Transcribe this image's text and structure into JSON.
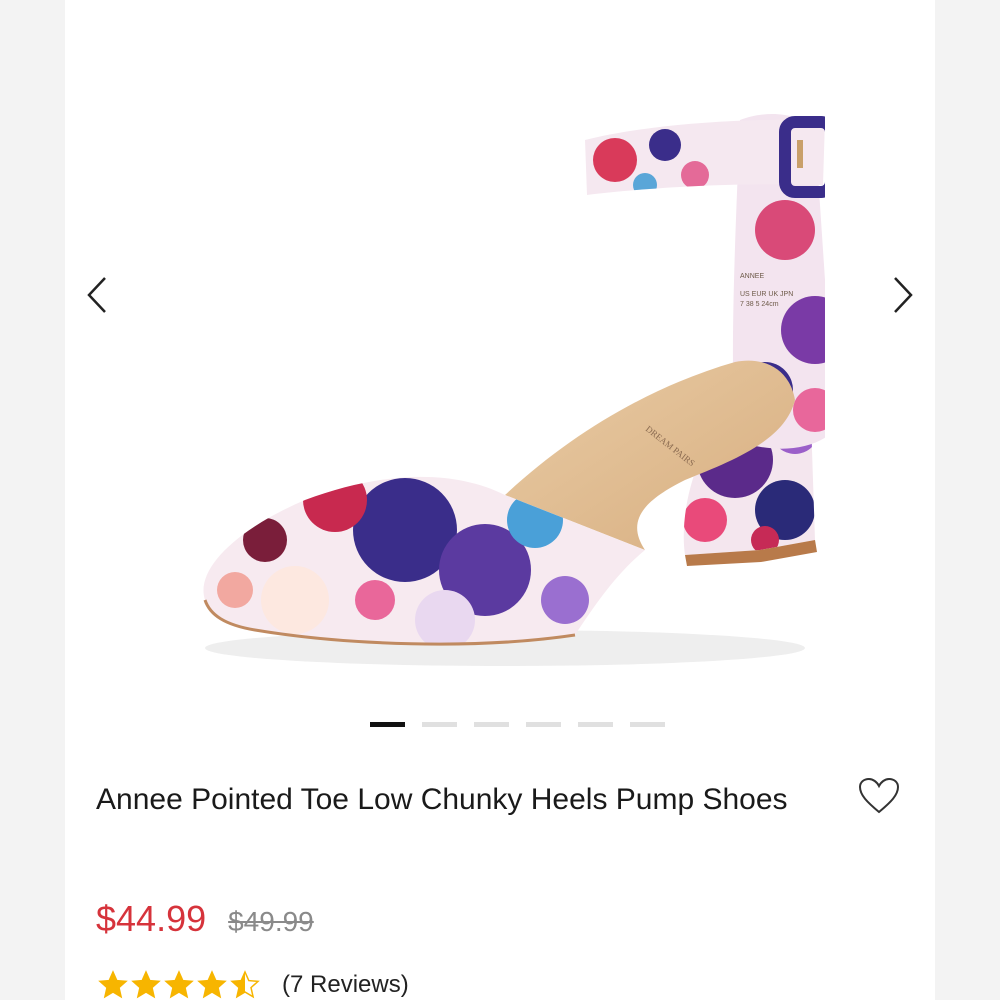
{
  "product": {
    "title": "Annee Pointed Toe Low Chunky Heels Pump Shoes",
    "price_current": "$44.99",
    "price_original": "$49.99",
    "rating": 4.5,
    "rating_max": 5,
    "reviews_label": "(7 Reviews)",
    "image_icon": "floral-ankle-strap-pump-shoe",
    "insole_brand": "DREAM PAIRS",
    "insole_model": "ANNEE",
    "insole_size_header": "US EUR UK JPN",
    "insole_size_values": "7 38 5 24cm"
  },
  "gallery": {
    "slide_count": 6,
    "active_index": 0,
    "prev_icon": "chevron-left-icon",
    "next_icon": "chevron-right-icon"
  },
  "icons": {
    "wishlist": "heart-outline-icon",
    "star": "star-icon"
  },
  "colors": {
    "price_current": "#d6333b",
    "price_original": "#8a8a8a",
    "star": "#f7b500",
    "dot_active": "#111111",
    "dot_inactive": "#e0e0e0"
  }
}
